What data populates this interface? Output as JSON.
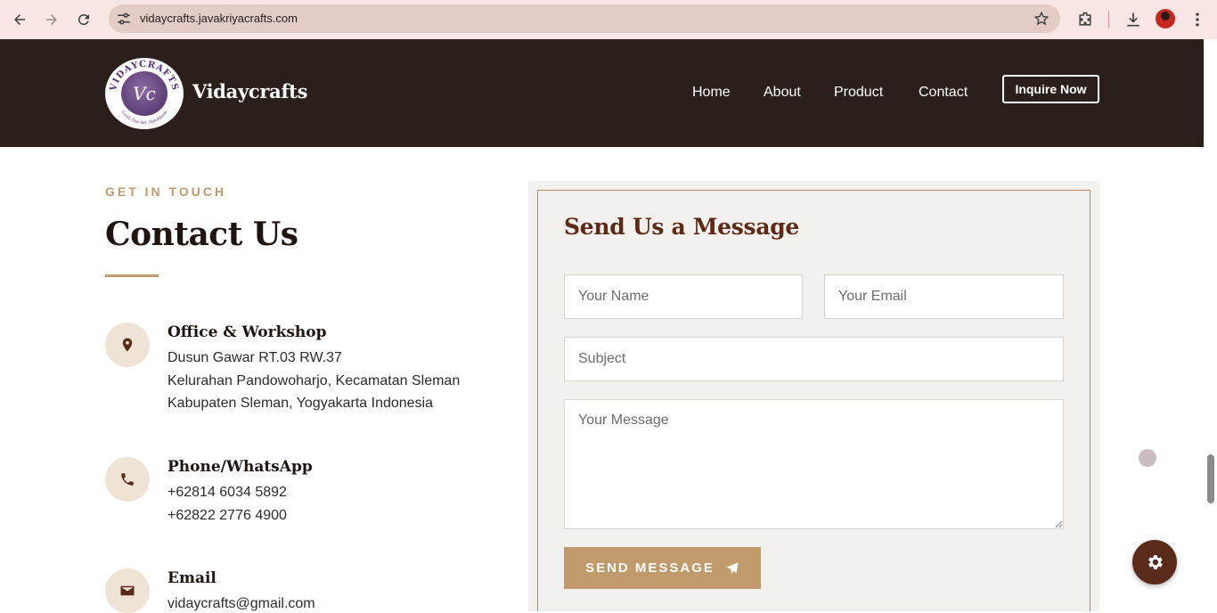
{
  "browser": {
    "url": "vidaycrafts.javakriyacrafts.com"
  },
  "header": {
    "brand": "Vidaycrafts",
    "logo_text": "VIDAYCRAFTS",
    "logo_monogram": "Vc",
    "logo_tagline": "Local, Our Art, Handmade",
    "nav": [
      {
        "label": "Home"
      },
      {
        "label": "About"
      },
      {
        "label": "Product"
      },
      {
        "label": "Contact"
      }
    ],
    "cta_label": "Inquire Now"
  },
  "contact": {
    "eyebrow": "GET IN TOUCH",
    "title": "Contact Us",
    "items": [
      {
        "icon": "location-pin-icon",
        "title": "Office & Workshop",
        "lines": [
          "Dusun Gawar RT.03 RW.37",
          "Kelurahan Pandowoharjo, Kecamatan Sleman",
          "Kabupaten Sleman, Yogyakarta Indonesia"
        ]
      },
      {
        "icon": "phone-icon",
        "title": "Phone/WhatsApp",
        "lines": [
          "+62814 6034 5892",
          "+62822 2776 4900"
        ]
      },
      {
        "icon": "envelope-icon",
        "title": "Email",
        "lines": [
          "vidaycrafts@gmail.com"
        ]
      }
    ]
  },
  "form": {
    "title": "Send Us a Message",
    "name_placeholder": "Your Name",
    "email_placeholder": "Your Email",
    "subject_placeholder": "Subject",
    "message_placeholder": "Your Message",
    "submit_label": "SEND MESSAGE"
  },
  "colors": {
    "header_bg": "#2a1f1a",
    "accent": "#c19a6b",
    "form_title": "#5e2a16",
    "icon_color": "#5a2a1a"
  }
}
